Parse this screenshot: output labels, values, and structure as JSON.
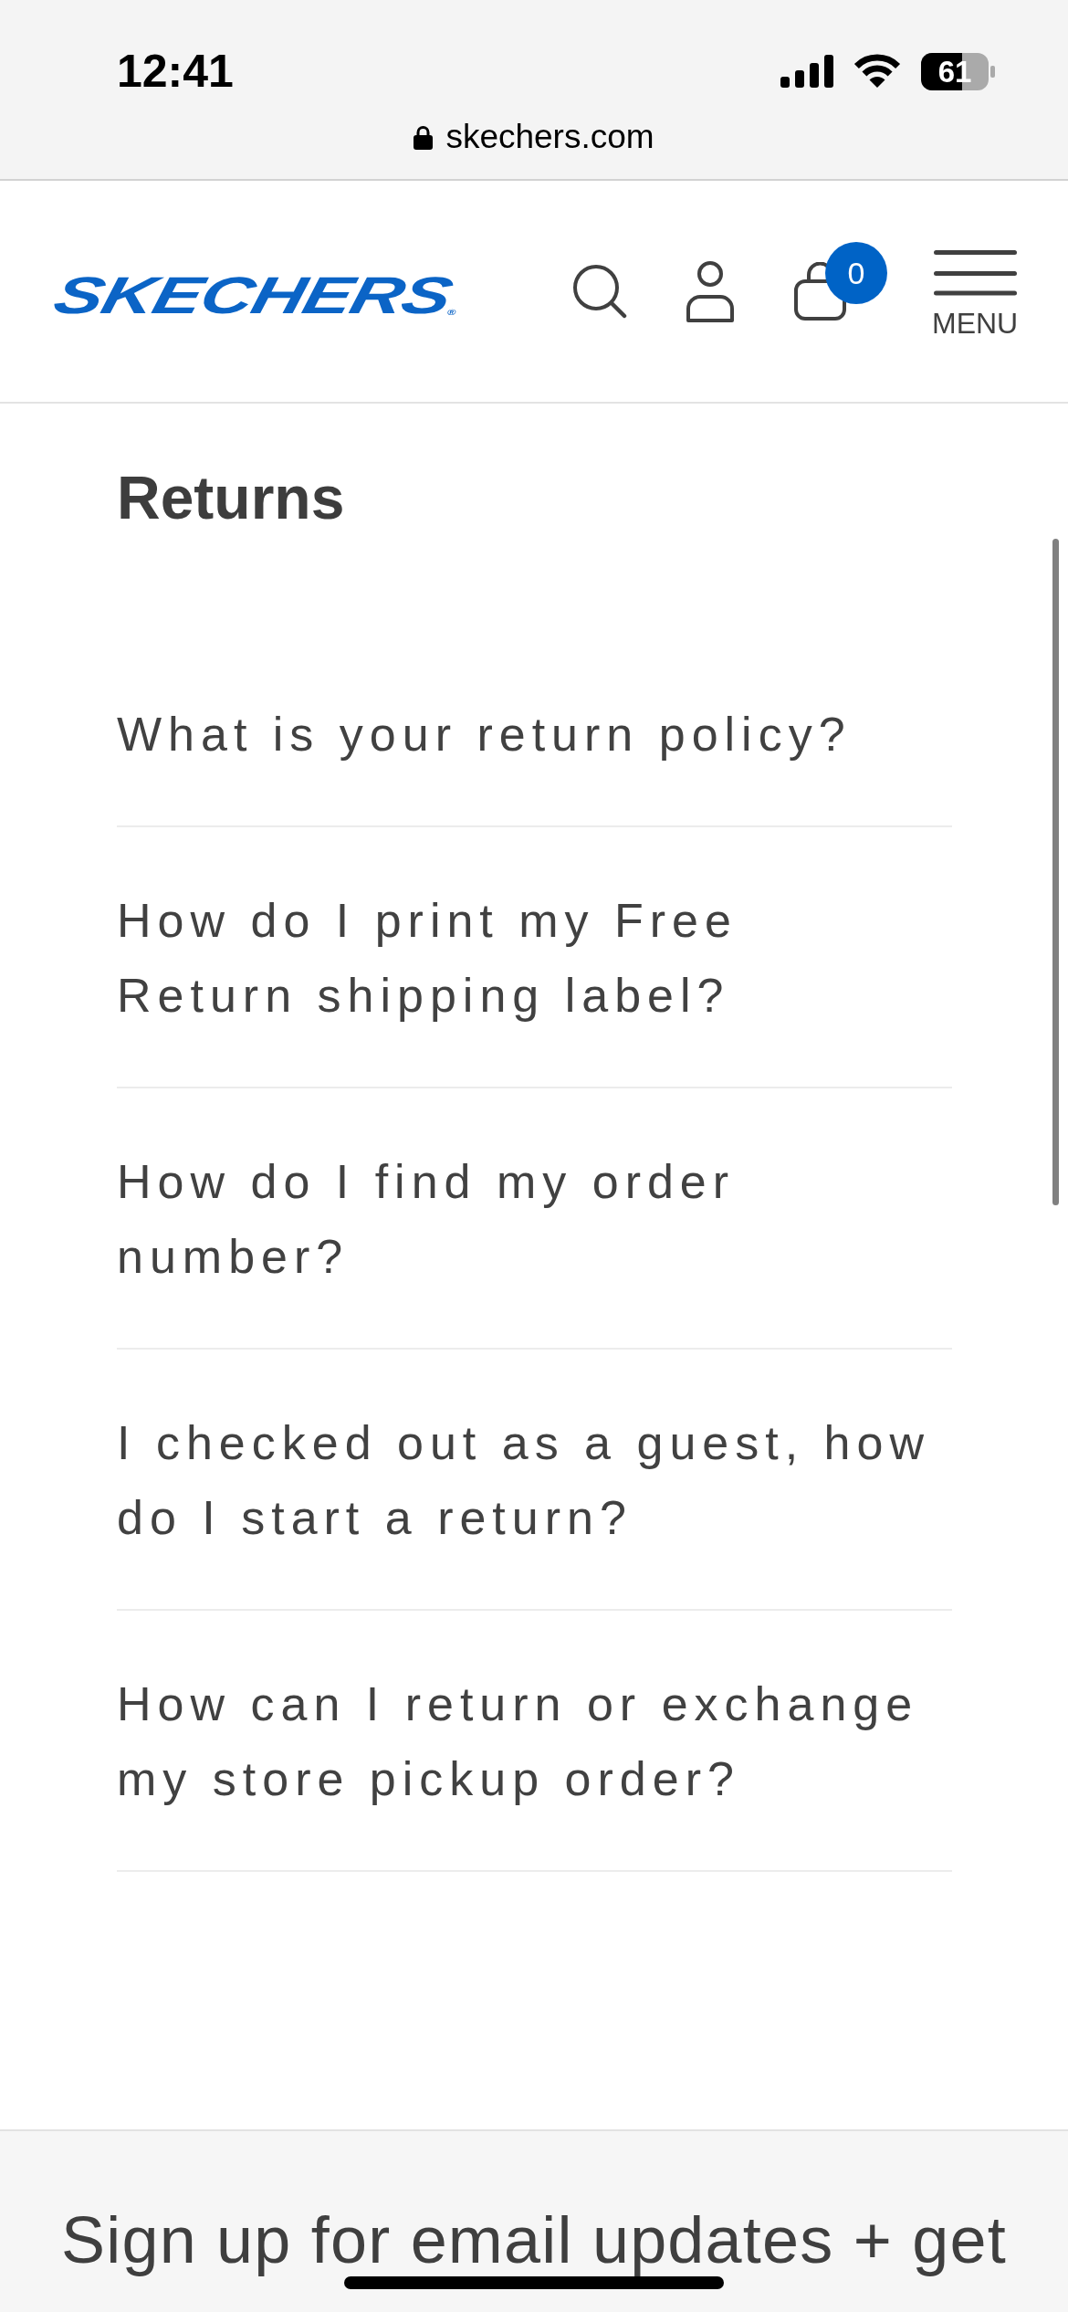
{
  "status_bar": {
    "time": "12:41",
    "battery_percent": "61"
  },
  "address_bar": {
    "url": "skechers.com"
  },
  "header": {
    "logo": "SKECHERS$_{®}$",
    "cart_count": "0",
    "menu_label": "MENU"
  },
  "faq_section": {
    "title": "Returns",
    "questions": [
      "What is your return policy?",
      "How do I print my Free\nReturn shipping label?",
      "How do I find my order\nnumber?",
      "I checked out as a guest, how\ndo I start a return?",
      "How can I return or exchange\nmy store pickup order?"
    ]
  },
  "footer": {
    "signup_text": "Sign up for email updates + get"
  }
}
